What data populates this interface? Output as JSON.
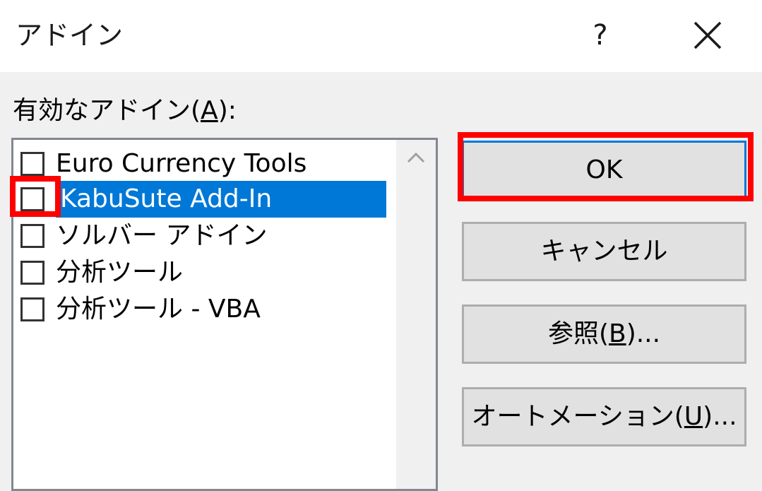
{
  "dialog": {
    "title": "アドイン",
    "help_label": "?"
  },
  "addins": {
    "label_prefix": "有効なアドイン(",
    "label_accel": "A",
    "label_suffix": "):",
    "items": [
      {
        "label": "Euro Currency Tools",
        "checked": false,
        "selected": false
      },
      {
        "label": "KabuSute Add-In",
        "checked": false,
        "selected": true
      },
      {
        "label": "ソルバー アドイン",
        "checked": false,
        "selected": false
      },
      {
        "label": "分析ツール",
        "checked": false,
        "selected": false
      },
      {
        "label": "分析ツール - VBA",
        "checked": false,
        "selected": false
      }
    ]
  },
  "buttons": {
    "ok": {
      "label": "OK"
    },
    "cancel": {
      "label": "キャンセル"
    },
    "browse": {
      "prefix": "参照(",
      "accel": "B",
      "suffix": ")..."
    },
    "automation": {
      "prefix": "オートメーション(",
      "accel": "U",
      "suffix": ")..."
    }
  },
  "colors": {
    "highlight_annotation": "#ff0000",
    "selection": "#0078d7",
    "button_face": "#e1e1e1"
  }
}
